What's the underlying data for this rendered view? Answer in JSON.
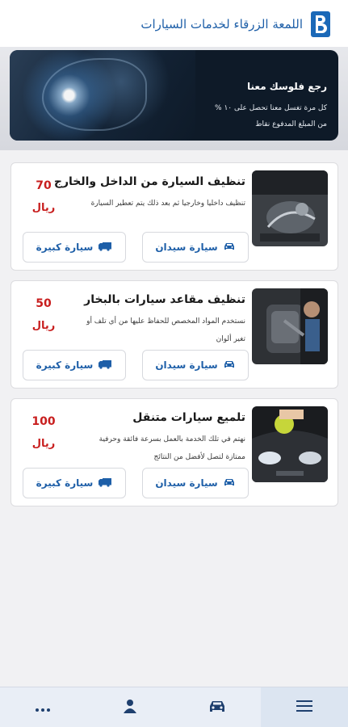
{
  "header": {
    "title": "اللمعة الزرقاء لخدمات السيارات",
    "logo_letter": "B"
  },
  "hero": {
    "title": "رجع فلوسك معنا",
    "line1": "كل مرة تغسل معنا تحصل على ١٠ %",
    "line2": "من المبلغ المدفوع نقاط"
  },
  "services": [
    {
      "title": "تنظيف السيارة من الداخل والخارج",
      "description": "تنظيف داخليا وخارجيا ثم بعد ذلك يتم تعطير السيارة",
      "price": "70",
      "currency": "ريال",
      "sedan_label": "سيارة سيدان",
      "large_label": "سيارة كبيرة"
    },
    {
      "title": "تنظيف مقاعد سيارات بالبخار",
      "description": "نستخدم المواد المخصص للحفاظ عليها من أي تلف أو تغير ألوان",
      "price": "50",
      "currency": "ريال",
      "sedan_label": "سيارة سيدان",
      "large_label": "سيارة كبيرة"
    },
    {
      "title": "تلميع سيارات متنقل",
      "description": "نهتم في تلك الخدمة بالعمل بسرعة فائقة وحرفية ممتازة لتصل لأفضل من النتائج",
      "price": "100",
      "currency": "ريال",
      "sedan_label": "سيارة سيدان",
      "large_label": "سيارة كبيرة"
    }
  ],
  "icons": {
    "sedan": "car-icon",
    "large": "truck-icon"
  },
  "bottom_nav": [
    {
      "name": "menu",
      "icon": "hamburger-icon",
      "active": true
    },
    {
      "name": "cars",
      "icon": "car-icon",
      "active": false
    },
    {
      "name": "profile",
      "icon": "user-icon",
      "active": false
    },
    {
      "name": "more",
      "icon": "more-dots-icon",
      "active": false
    }
  ],
  "colors": {
    "brand": "#1e5fa8",
    "price": "#c81e1e",
    "nav_bg": "#e9eef6"
  }
}
